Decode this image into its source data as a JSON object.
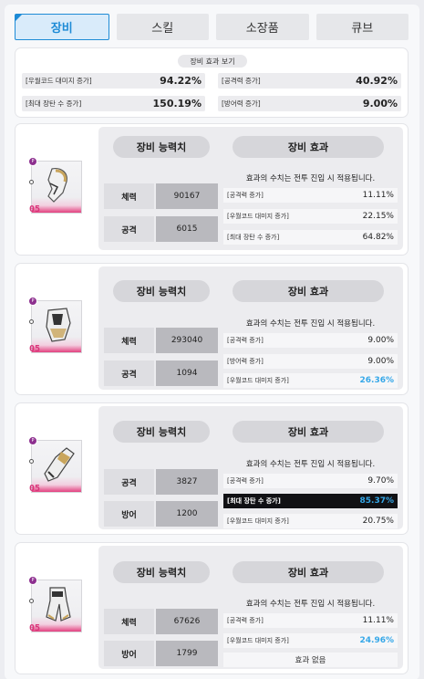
{
  "tabs": [
    "장비",
    "스킬",
    "소장품",
    "큐브"
  ],
  "summary": {
    "title": "장비 효과 보기",
    "rows": [
      {
        "label": "[우월코드 대미지 증가]",
        "value": "94.22%"
      },
      {
        "label": "[공격력 증가]",
        "value": "40.92%"
      },
      {
        "label": "[최대 장탄 수 증가]",
        "value": "150.19%"
      },
      {
        "label": "[방어력 증가]",
        "value": "9.00%"
      }
    ]
  },
  "labels": {
    "stats_title": "장비 능력치",
    "effects_title": "장비 효과",
    "effects_note": "효과의 수치는 전투 진입 시 적용됩니다."
  },
  "cards": [
    {
      "level": "05",
      "badge": "P",
      "stats": [
        {
          "label": "체력",
          "value": "90167"
        },
        {
          "label": "공격",
          "value": "6015"
        }
      ],
      "effects": [
        {
          "label": "[공격력 증가]",
          "value": "11.11%"
        },
        {
          "label": "[우월코드 대미지 증가]",
          "value": "22.15%"
        },
        {
          "label": "[최대 장탄 수 증가]",
          "value": "64.82%"
        }
      ]
    },
    {
      "level": "05",
      "badge": "P",
      "stats": [
        {
          "label": "체력",
          "value": "293040"
        },
        {
          "label": "공격",
          "value": "1094"
        }
      ],
      "effects": [
        {
          "label": "[공격력 증가]",
          "value": "9.00%"
        },
        {
          "label": "[방어력 증가]",
          "value": "9.00%"
        },
        {
          "label": "[우월코드 대미지 증가]",
          "value": "26.36%"
        }
      ]
    },
    {
      "level": "05",
      "badge": "P",
      "stats": [
        {
          "label": "공격",
          "value": "3827"
        },
        {
          "label": "방어",
          "value": "1200"
        }
      ],
      "effects": [
        {
          "label": "[공격력 증가]",
          "value": "9.70%"
        },
        {
          "label": "[최대 장탄 수 증가]",
          "value": "85.37%"
        },
        {
          "label": "[우월코드 대미지 증가]",
          "value": "20.75%"
        }
      ]
    },
    {
      "level": "05",
      "badge": "P",
      "stats": [
        {
          "label": "체력",
          "value": "67626"
        },
        {
          "label": "방어",
          "value": "1799"
        }
      ],
      "effects": [
        {
          "label": "[공격력 증가]",
          "value": "11.11%"
        },
        {
          "label": "[우월코드 대미지 증가]",
          "value": "24.96%"
        },
        {
          "label": "효과 없음",
          "value": ""
        }
      ]
    }
  ],
  "colors": {
    "accent": "#1e8bd6",
    "highlight_value": "#35a7e8",
    "level": "#d9347a"
  }
}
